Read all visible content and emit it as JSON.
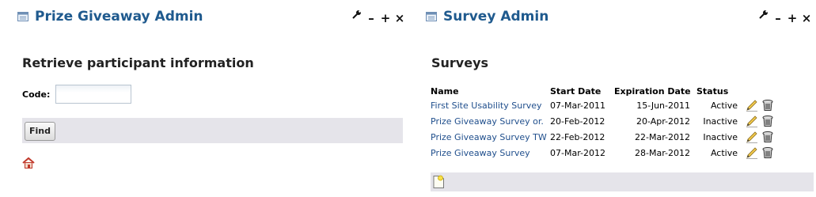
{
  "prize_portlet": {
    "title": "Prize Giveaway Admin",
    "controls": {
      "configure": "configure-icon",
      "minimize": "–",
      "maximize": "+",
      "close": "×"
    },
    "heading": "Retrieve participant information",
    "code_label": "Code:",
    "code_value": "",
    "find_label": "Find",
    "home_icon": "home-icon"
  },
  "survey_portlet": {
    "title": "Survey Admin",
    "controls": {
      "configure": "configure-icon",
      "minimize": "–",
      "maximize": "+",
      "close": "×"
    },
    "heading": "Surveys",
    "columns": [
      "Name",
      "Start Date",
      "Expiration Date",
      "Status"
    ],
    "rows": [
      {
        "name": "First Site Usability Survey",
        "start": "07-Mar-2011",
        "expiration": "15-Jun-2011",
        "status": "Active"
      },
      {
        "name": "Prize Giveaway Survey or.",
        "start": "20-Feb-2012",
        "expiration": "20-Apr-2012",
        "status": "Inactive"
      },
      {
        "name": "Prize Giveaway Survey TW",
        "start": "22-Feb-2012",
        "expiration": "22-Mar-2012",
        "status": "Inactive"
      },
      {
        "name": "Prize Giveaway Survey",
        "start": "07-Mar-2012",
        "expiration": "28-Mar-2012",
        "status": "Active"
      }
    ],
    "row_action_icons": [
      "edit-pencil-icon",
      "delete-trash-icon"
    ],
    "new_survey_icon": "new-document-icon"
  },
  "colors": {
    "title_blue": "#1f5a8e",
    "link_blue": "#1f4e8c",
    "bar_gray": "#e5e4ea"
  }
}
